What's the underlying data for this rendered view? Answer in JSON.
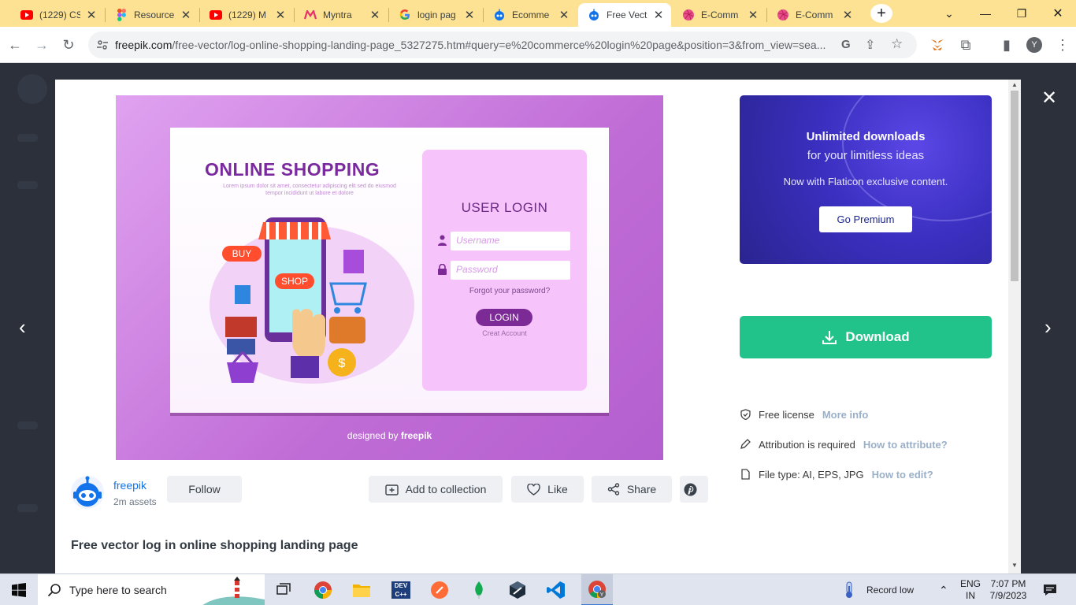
{
  "browser": {
    "tabs": [
      {
        "title": "(1229) CS",
        "icon": "youtube-icon"
      },
      {
        "title": "Resource",
        "icon": "figma-icon"
      },
      {
        "title": "(1229) M",
        "icon": "youtube-icon"
      },
      {
        "title": "Myntra",
        "icon": "myntra-icon"
      },
      {
        "title": "login pag",
        "icon": "google-icon"
      },
      {
        "title": "Ecomme",
        "icon": "freepik-icon"
      },
      {
        "title": "Free Vect",
        "icon": "freepik-icon",
        "active": true
      },
      {
        "title": "E-Comm",
        "icon": "dribbble-icon"
      },
      {
        "title": "E-Comm",
        "icon": "dribbble-icon"
      }
    ],
    "url_host": "freepik.com",
    "url_path": "/free-vector/log-online-shopping-landing-page_5327275.htm#query=e%20commerce%20login%20page&position=3&from_view=sea..."
  },
  "preview": {
    "title": "ONLINE SHOPPING",
    "lorem": "Lorem ipsum dolor sit amet, consectetur adipiscing elit sed do eiusmod tempor incididunt ut labore et dolore",
    "buy": "BUY",
    "shop": "SHOP",
    "login_title": "USER LOGIN",
    "username_placeholder": "Username",
    "password_placeholder": "Password",
    "forgot": "Forgot your password?",
    "login_btn": "LOGIN",
    "create": "Creat Account",
    "credit_prefix": "designed by",
    "credit_brand": "freepik"
  },
  "promo": {
    "headline": "Unlimited downloads",
    "subline": "for your limitless ideas",
    "note": "Now with Flaticon exclusive content.",
    "button": "Go Premium"
  },
  "download_label": "Download",
  "license": {
    "free": "Free license",
    "free_link": "More info",
    "attribution": "Attribution is required",
    "attribution_link": "How to attribute?",
    "filetype": "File type: AI, EPS, JPG",
    "filetype_link": "How to edit?"
  },
  "author": {
    "name": "freepik",
    "assets": "2m assets",
    "follow": "Follow"
  },
  "actions": {
    "collection": "Add to collection",
    "like": "Like",
    "share": "Share"
  },
  "description": "Free vector log in online shopping landing page",
  "taskbar": {
    "search_placeholder": "Type here to search",
    "record": "Record low",
    "lang1": "ENG",
    "lang2": "IN",
    "time": "7:07 PM",
    "date": "7/9/2023"
  },
  "colors": {
    "accent_download": "#22c38a",
    "promo": "#3a2fc0",
    "chrome_frame": "#fde293",
    "brand_purple": "#7a2a9e"
  }
}
